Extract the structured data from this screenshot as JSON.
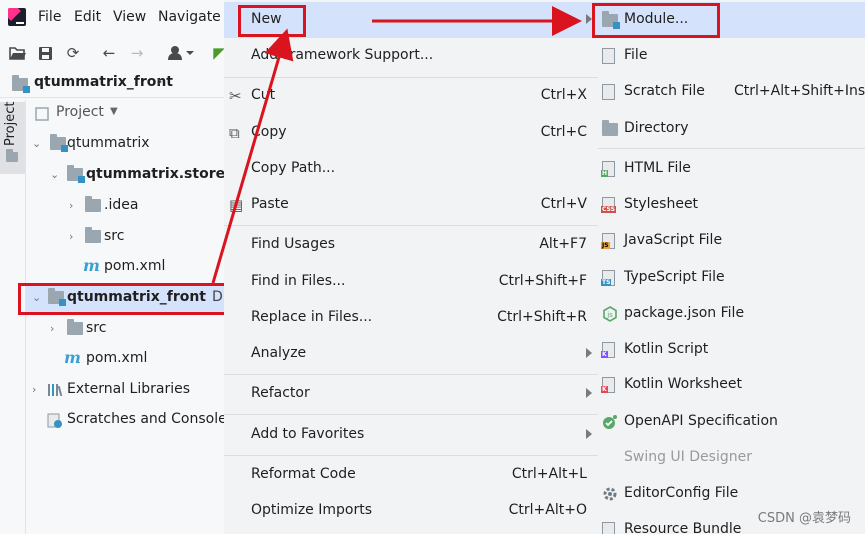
{
  "menubar": {
    "items": [
      "File",
      "Edit",
      "View",
      "Navigate"
    ]
  },
  "navbar": {
    "project": "qtummatrix_front"
  },
  "sidebar": {
    "tab_label": "Project"
  },
  "project_view": {
    "header": "Project",
    "tree": [
      {
        "label": "qtummatrix"
      },
      {
        "label": "qtummatrix.store"
      },
      {
        "label": ".idea"
      },
      {
        "label": "src"
      },
      {
        "label": "pom.xml"
      },
      {
        "label": "qtummatrix_front",
        "path": "D:\\A_"
      },
      {
        "label": "src"
      },
      {
        "label": "pom.xml"
      },
      {
        "label": "External Libraries"
      },
      {
        "label": "Scratches and Consoles"
      }
    ]
  },
  "context_menu": {
    "items": [
      {
        "label": "New",
        "shortcut": ""
      },
      {
        "label": "Add Framework Support...",
        "shortcut": ""
      },
      {
        "label": "Cut",
        "shortcut": "Ctrl+X"
      },
      {
        "label": "Copy",
        "shortcut": "Ctrl+C"
      },
      {
        "label": "Copy Path...",
        "shortcut": ""
      },
      {
        "label": "Paste",
        "shortcut": "Ctrl+V"
      },
      {
        "label": "Find Usages",
        "shortcut": "Alt+F7"
      },
      {
        "label": "Find in Files...",
        "shortcut": "Ctrl+Shift+F"
      },
      {
        "label": "Replace in Files...",
        "shortcut": "Ctrl+Shift+R"
      },
      {
        "label": "Analyze",
        "shortcut": ""
      },
      {
        "label": "Refactor",
        "shortcut": ""
      },
      {
        "label": "Add to Favorites",
        "shortcut": ""
      },
      {
        "label": "Reformat Code",
        "shortcut": "Ctrl+Alt+L"
      },
      {
        "label": "Optimize Imports",
        "shortcut": "Ctrl+Alt+O"
      }
    ]
  },
  "submenu_new": {
    "items": [
      {
        "label": "Module...",
        "icon": "module-icon"
      },
      {
        "label": "File",
        "icon": "file-icon"
      },
      {
        "label": "Scratch File",
        "icon": "scratch-file-icon",
        "shortcut": "Ctrl+Alt+Shift+Insert"
      },
      {
        "label": "Directory",
        "icon": "directory-icon"
      },
      {
        "label": "HTML File",
        "icon": "html-file-icon"
      },
      {
        "label": "Stylesheet",
        "icon": "stylesheet-icon"
      },
      {
        "label": "JavaScript File",
        "icon": "javascript-file-icon"
      },
      {
        "label": "TypeScript File",
        "icon": "typescript-file-icon"
      },
      {
        "label": "package.json File",
        "icon": "package-json-icon"
      },
      {
        "label": "Kotlin Script",
        "icon": "kotlin-script-icon"
      },
      {
        "label": "Kotlin Worksheet",
        "icon": "kotlin-worksheet-icon"
      },
      {
        "label": "OpenAPI Specification",
        "icon": "openapi-icon"
      },
      {
        "label": "Swing UI Designer",
        "icon": ""
      },
      {
        "label": "EditorConfig File",
        "icon": "editorconfig-icon"
      },
      {
        "label": "Resource Bundle",
        "icon": "resource-bundle-icon"
      }
    ]
  },
  "watermark": "CSDN @袁梦码",
  "colors": {
    "highlight": "#d4e2fb",
    "annotation": "#d9141e",
    "menu_bg": "#f2f3f5"
  }
}
